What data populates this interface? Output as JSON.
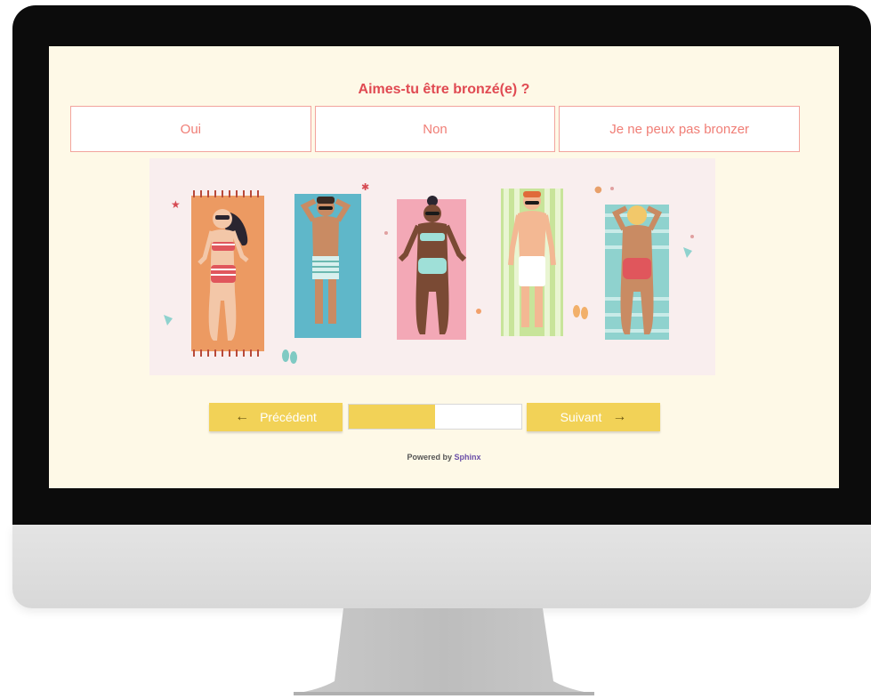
{
  "survey": {
    "question": "Aimes-tu être bronzé(e) ?",
    "choices": [
      "Oui",
      "Non",
      "Je ne peux pas bronzer"
    ]
  },
  "nav": {
    "prev_label": "Précédent",
    "next_label": "Suivant",
    "prev_icon": "arrow-left-icon",
    "next_icon": "arrow-right-icon",
    "progress_percent": 50
  },
  "footer": {
    "powered_prefix": "Powered by",
    "powered_brand": "Sphinx"
  },
  "colors": {
    "accent": "#f2d257",
    "question": "#e04a52",
    "choice_border": "#f2a49d",
    "screen_bg": "#fef9e7",
    "brand": "#6b4fa8"
  }
}
